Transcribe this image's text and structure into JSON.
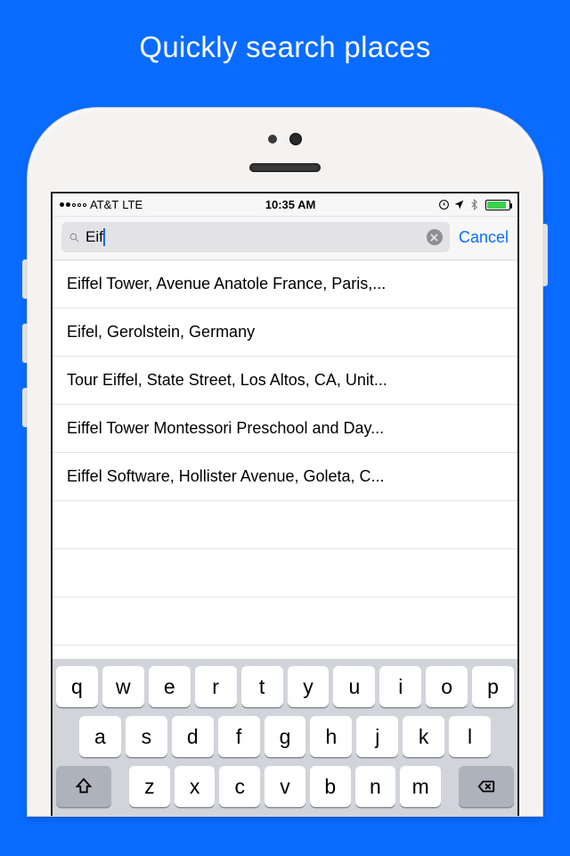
{
  "promo": {
    "title": "Quickly search places"
  },
  "statusbar": {
    "carrier": "AT&T",
    "network": "LTE",
    "time": "10:35 AM"
  },
  "search": {
    "query": "Eif",
    "cancel_label": "Cancel"
  },
  "results": [
    "Eiffel Tower, Avenue Anatole France, Paris,...",
    "Eifel, Gerolstein, Germany",
    "Tour Eiffel, State Street, Los Altos, CA, Unit...",
    "Eiffel Tower Montessori Preschool and Day...",
    "Eiffel Software, Hollister Avenue, Goleta, C..."
  ],
  "keyboard": {
    "rows": [
      [
        "q",
        "w",
        "e",
        "r",
        "t",
        "y",
        "u",
        "i",
        "o",
        "p"
      ],
      [
        "a",
        "s",
        "d",
        "f",
        "g",
        "h",
        "j",
        "k",
        "l"
      ],
      [
        "z",
        "x",
        "c",
        "v",
        "b",
        "n",
        "m"
      ]
    ]
  }
}
